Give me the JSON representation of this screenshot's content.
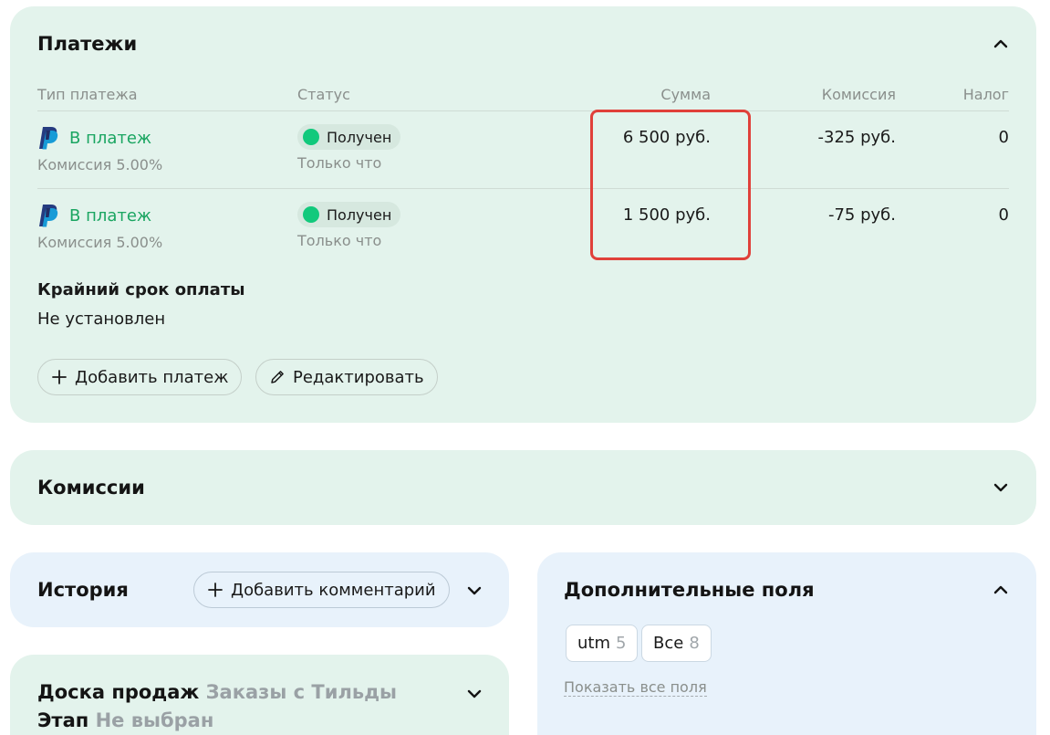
{
  "payments": {
    "title": "Платежи",
    "columns": {
      "type": "Тип платежа",
      "status": "Статус",
      "amount": "Сумма",
      "commission": "Комиссия",
      "tax": "Налог"
    },
    "rows": [
      {
        "type_label": "В платеж",
        "commission_note": "Комиссия 5.00%",
        "status": "Получен",
        "status_time": "Только что",
        "amount": "6 500 руб.",
        "commission": "-325 руб.",
        "tax": "0"
      },
      {
        "type_label": "В платеж",
        "commission_note": "Комиссия 5.00%",
        "status": "Получен",
        "status_time": "Только что",
        "amount": "1 500 руб.",
        "commission": "-75 руб.",
        "tax": "0"
      }
    ],
    "deadline_label": "Крайний срок оплаты",
    "deadline_value": "Не установлен",
    "add_payment_label": "Добавить платеж",
    "edit_label": "Редактировать"
  },
  "commissions": {
    "title": "Комиссии"
  },
  "history": {
    "title": "История",
    "add_comment_label": "Добавить комментарий"
  },
  "sales_board": {
    "title": "Доска продаж",
    "board_name": "Заказы с Тильды",
    "stage_label": "Этап",
    "stage_value": "Не выбран"
  },
  "extra_fields": {
    "title": "Дополнительные поля",
    "chips": [
      {
        "label": "utm",
        "count": "5"
      },
      {
        "label": "Все",
        "count": "8"
      }
    ],
    "show_all_label": "Показать все поля"
  },
  "colors": {
    "card_green": "#e3f3ec",
    "card_blue": "#e8f2fb",
    "link_green": "#1aa561",
    "status_dot": "#12c97c",
    "highlight_red": "#e0403a"
  },
  "icons": [
    "paypal-icon",
    "chevron-up-icon",
    "chevron-down-icon",
    "plus-icon",
    "pencil-icon"
  ]
}
